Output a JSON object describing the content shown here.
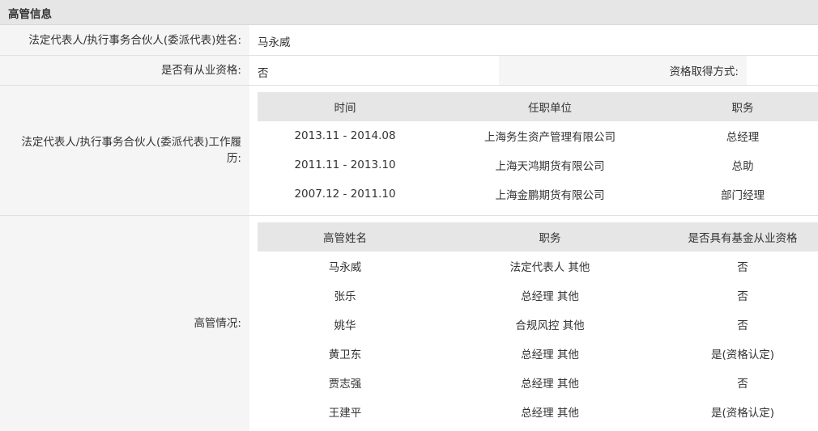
{
  "section_title": "高管信息",
  "legal_rep": {
    "label": "法定代表人/执行事务合伙人(委派代表)姓名:",
    "value": "马永威"
  },
  "qualification": {
    "label": "是否有从业资格:",
    "value": "否",
    "method_label": "资格取得方式:",
    "method_value": ""
  },
  "work_history": {
    "label": "法定代表人/执行事务合伙人(委派代表)工作履历:",
    "headers": [
      "时间",
      "任职单位",
      "职务"
    ],
    "rows": [
      [
        "2013.11 - 2014.08",
        "上海务生资产管理有限公司",
        "总经理"
      ],
      [
        "2011.11 - 2013.10",
        "上海天鸿期货有限公司",
        "总助"
      ],
      [
        "2007.12 - 2011.10",
        "上海金鹏期货有限公司",
        "部门经理"
      ]
    ]
  },
  "executives": {
    "label": "高管情况:",
    "headers": [
      "高管姓名",
      "职务",
      "是否具有基金从业资格"
    ],
    "rows": [
      [
        "马永威",
        "法定代表人 其他",
        "否"
      ],
      [
        "张乐",
        "总经理 其他",
        "否"
      ],
      [
        "姚华",
        "合规风控 其他",
        "否"
      ],
      [
        "黄卫东",
        "总经理 其他",
        "是(资格认定)"
      ],
      [
        "贾志强",
        "总经理 其他",
        "否"
      ],
      [
        "王建平",
        "总经理 其他",
        "是(资格认定)"
      ]
    ]
  }
}
